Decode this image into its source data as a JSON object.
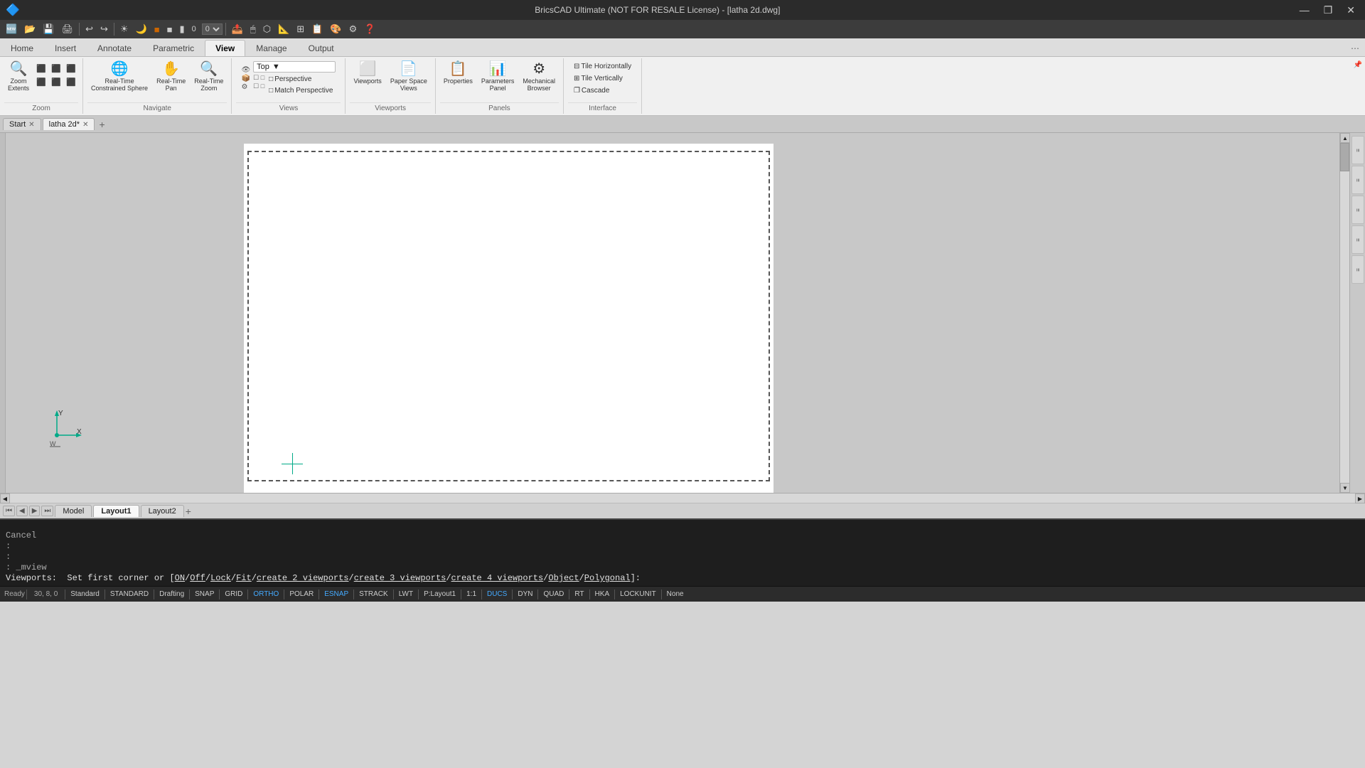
{
  "titlebar": {
    "title": "BricsCAD Ultimate (NOT FOR RESALE License) - [latha 2d.dwg]",
    "minimize_label": "—",
    "restore_label": "❐",
    "close_label": "✕"
  },
  "quickaccess": {
    "buttons": [
      "🆕",
      "📂",
      "💾",
      "🖨",
      "↩",
      "↪",
      "🌐",
      "🔆",
      "🔅",
      "🌑",
      "🟫",
      "▮",
      "▮0"
    ]
  },
  "ribbon": {
    "tabs": [
      {
        "label": "Home",
        "active": true
      },
      {
        "label": "Insert"
      },
      {
        "label": "Annotate"
      },
      {
        "label": "Parametric"
      },
      {
        "label": "View",
        "active_main": true
      },
      {
        "label": "Manage"
      },
      {
        "label": "Output"
      }
    ],
    "groups": {
      "zoom": {
        "label": "Zoom",
        "buttons": [
          {
            "icon": "🔍",
            "label": "Zoom\nExtents"
          },
          {
            "rows": [
              [
                "⬛",
                "⬛",
                "⬛"
              ],
              [
                "⬛",
                "⬛",
                "⬛"
              ]
            ]
          }
        ]
      },
      "navigate": {
        "label": "Navigate",
        "buttons": [
          {
            "icon": "🌐",
            "label": "Real-Time\nConstrained Sphere"
          },
          {
            "icon": "✋",
            "label": "Real-Time\nPan"
          },
          {
            "icon": "🔍",
            "label": "Real-Time\nZoom"
          }
        ]
      },
      "views": {
        "label": "Views",
        "view_dropdown": "Top",
        "sub_buttons": [
          {
            "label": "Perspective"
          },
          {
            "label": "Match Perspective"
          }
        ]
      },
      "viewports": {
        "label": "Viewports",
        "buttons": [
          {
            "icon": "⬜",
            "label": "Viewports"
          },
          {
            "icon": "📄",
            "label": "Paper Space\nViews"
          }
        ]
      },
      "panels": {
        "label": "Panels",
        "buttons": [
          {
            "icon": "📋",
            "label": "Properties"
          },
          {
            "icon": "📊",
            "label": "Parameters\nPanel"
          },
          {
            "icon": "⚙",
            "label": "Mechanical\nBrowser"
          }
        ]
      },
      "interface": {
        "label": "Interface",
        "buttons": [
          {
            "label": "Tile Horizontally"
          },
          {
            "label": "Tile Vertically"
          },
          {
            "label": "Cascade"
          }
        ]
      }
    }
  },
  "doc_tabs": [
    {
      "label": "Start",
      "closeable": true
    },
    {
      "label": "latha 2d*",
      "closeable": true,
      "active": true
    }
  ],
  "layout_tabs": [
    {
      "label": "Model"
    },
    {
      "label": "Layout1",
      "active": true
    },
    {
      "label": "Layout2"
    }
  ],
  "command_history": [
    "Cancel",
    ":",
    ":",
    ": _mview"
  ],
  "command_prompt": "Viewports:  Set first corner or [ON/Off/Lock/Fit/create 2 viewports/create 3 viewports/create 4 viewports/Object/Polygonal]:",
  "statusbar": {
    "coords": "30, 8, 0",
    "items": [
      {
        "label": "Standard",
        "active": false
      },
      {
        "label": "STANDARD",
        "active": false
      },
      {
        "label": "Drafting",
        "active": false
      },
      {
        "label": "SNAP",
        "active": false
      },
      {
        "label": "GRID",
        "active": false
      },
      {
        "label": "ORTHO",
        "active": true
      },
      {
        "label": "POLAR",
        "active": false
      },
      {
        "label": "ESNAP",
        "active": true
      },
      {
        "label": "STRACK",
        "active": false
      },
      {
        "label": "LWT",
        "active": false
      },
      {
        "label": "P:Layout1",
        "active": false
      },
      {
        "label": "1:1",
        "active": false
      },
      {
        "label": "DUCS",
        "active": true
      },
      {
        "label": "DYN",
        "active": false
      },
      {
        "label": "QUAD",
        "active": false
      },
      {
        "label": "RT",
        "active": false
      },
      {
        "label": "HKA",
        "active": false
      },
      {
        "label": "LOCKUNIT",
        "active": false
      },
      {
        "label": "None",
        "active": false
      }
    ],
    "ready": "Ready"
  },
  "right_panels": [
    {
      "label": "≡"
    },
    {
      "label": "≡"
    },
    {
      "label": "≡"
    },
    {
      "label": "≡"
    },
    {
      "label": "≡"
    }
  ]
}
